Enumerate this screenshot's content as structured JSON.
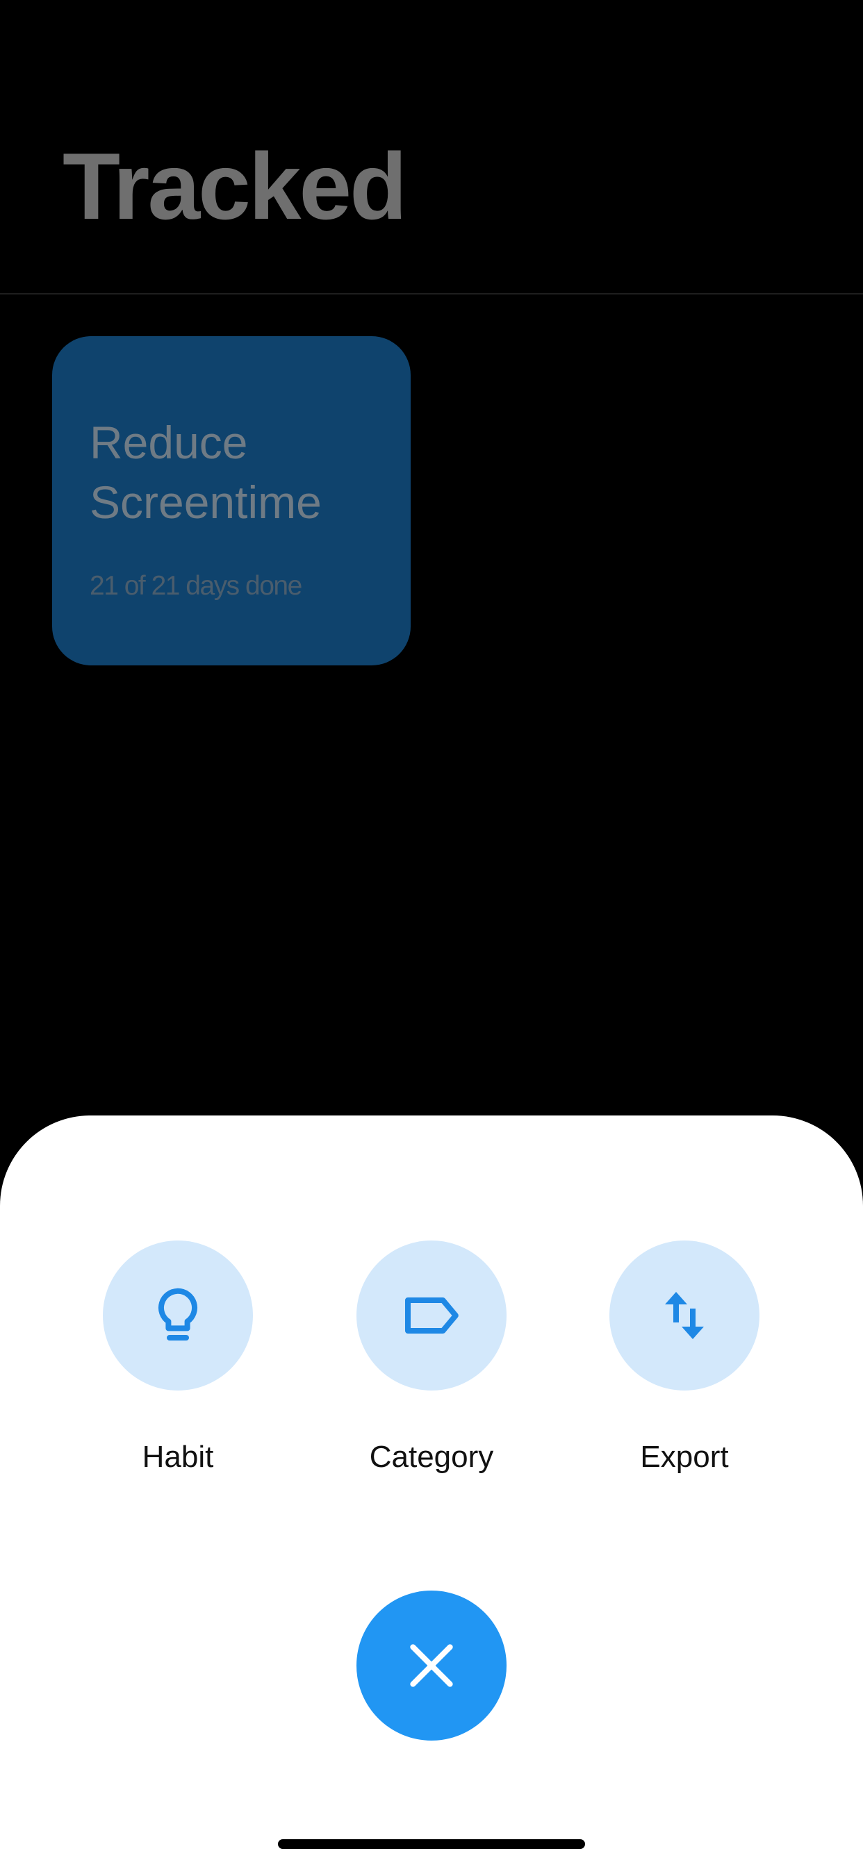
{
  "header": {
    "title": "Tracked"
  },
  "habits": [
    {
      "title": "Reduce\nScreentime",
      "progress": "21 of 21 days done"
    }
  ],
  "sheet": {
    "actions": [
      {
        "label": "Habit",
        "icon": "lightbulb-icon"
      },
      {
        "label": "Category",
        "icon": "label-tag-icon"
      },
      {
        "label": "Export",
        "icon": "swap-vertical-icon"
      }
    ],
    "close_icon": "close-icon"
  },
  "colors": {
    "background": "#000000",
    "title_dimmed": "#6f6f6f",
    "card": "#0f436d",
    "sheet": "#ffffff",
    "action_circle": "#d3e8fb",
    "accent": "#2196f3",
    "label": "#111111"
  }
}
